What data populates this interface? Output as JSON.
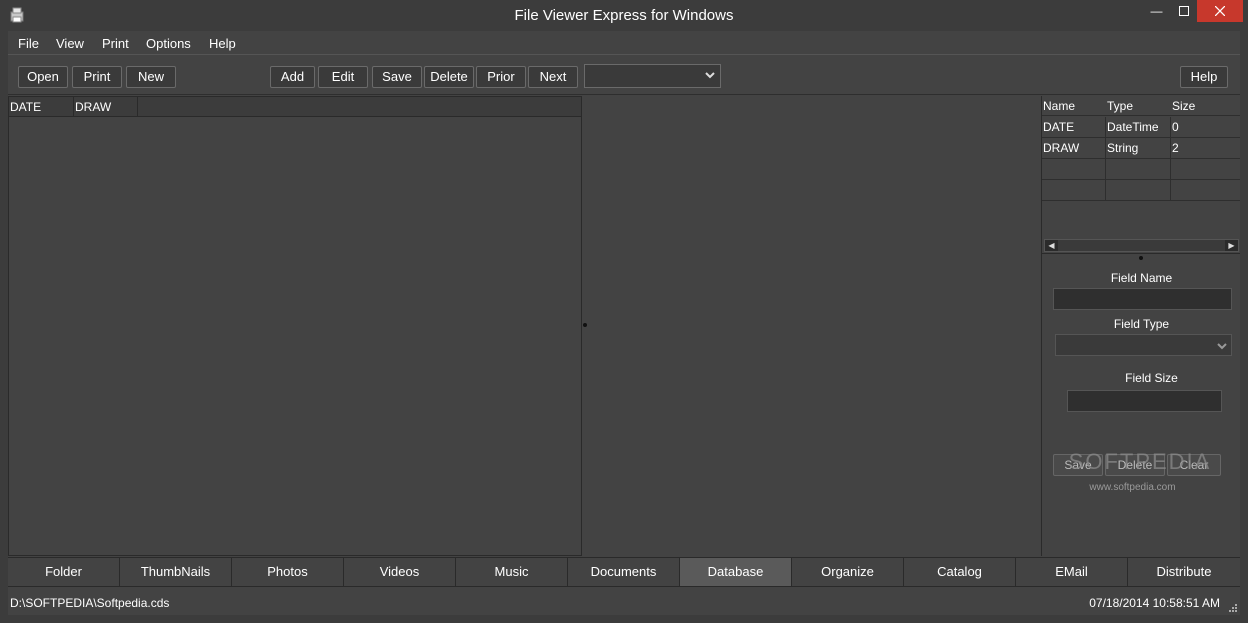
{
  "window": {
    "title": "File Viewer Express for Windows"
  },
  "menu": [
    "File",
    "View",
    "Print",
    "Options",
    "Help"
  ],
  "toolbar": {
    "left_buttons": [
      "Open",
      "Print",
      "New"
    ],
    "record_buttons": [
      "Add",
      "Edit",
      "Save",
      "Delete",
      "Prior",
      "Next"
    ],
    "combo_value": "",
    "help": "Help"
  },
  "data_grid": {
    "columns": [
      "DATE",
      "DRAW"
    ],
    "rows": []
  },
  "fields_grid": {
    "columns": [
      "Name",
      "Type",
      "Size"
    ],
    "rows": [
      [
        "DATE",
        "DateTime",
        "0"
      ],
      [
        "DRAW",
        "String",
        "2"
      ],
      [
        "",
        "",
        ""
      ],
      [
        "",
        "",
        ""
      ]
    ]
  },
  "field_editor": {
    "name_label": "Field Name",
    "name_value": "",
    "type_label": "Field Type",
    "type_value": "",
    "size_label": "Field Size",
    "size_value": "",
    "save": "Save",
    "delete": "Delete",
    "clear": "Clear"
  },
  "watermark": {
    "text": "SOFTPEDIA",
    "url": "www.softpedia.com"
  },
  "tabs": [
    "Folder",
    "ThumbNails",
    "Photos",
    "Videos",
    "Music",
    "Documents",
    "Database",
    "Organize",
    "Catalog",
    "EMail",
    "Distribute"
  ],
  "active_tab": "Database",
  "status": {
    "path": "D:\\SOFTPEDIA\\Softpedia.cds",
    "datetime": "07/18/2014 10:58:51 AM"
  }
}
